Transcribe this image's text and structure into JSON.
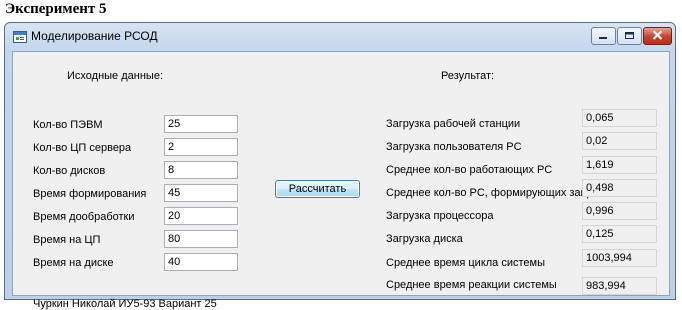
{
  "document": {
    "heading": "Эксперимент 5"
  },
  "window": {
    "title": "Моделирование РСОД"
  },
  "input_section": {
    "header": "Исходные данные:",
    "fields": [
      {
        "label": "Кол-во ПЭВМ",
        "value": "25"
      },
      {
        "label": "Кол-во ЦП сервера",
        "value": "2"
      },
      {
        "label": "Кол-во дисков",
        "value": "8"
      },
      {
        "label": "Время формирования",
        "value": "45"
      },
      {
        "label": "Время дообработки",
        "value": "20"
      },
      {
        "label": "Время на ЦП",
        "value": "80"
      },
      {
        "label": "Время на диске",
        "value": "40"
      }
    ]
  },
  "calculate_button": {
    "label": "Рассчитать"
  },
  "result_section": {
    "header": "Результат:",
    "fields": [
      {
        "label": "Загрузка рабочей станции",
        "value": "0,065"
      },
      {
        "label": "Загрузка пользователя PC",
        "value": "0,02"
      },
      {
        "label": "Среднее кол-во работающих PC",
        "value": "1,619"
      },
      {
        "label": "Среднее кол-во PC, формирующих запрос",
        "value": "0,498"
      },
      {
        "label": "Загрузка процессора",
        "value": "0,996"
      },
      {
        "label": "Загрузка диска",
        "value": "0,125"
      },
      {
        "label": "Среднее время цикла системы",
        "value": "1003,994"
      },
      {
        "label": "Среднее время реакции системы",
        "value": "983,994"
      }
    ]
  },
  "footer": {
    "text": "Чуркин Николай ИУ5-93 Вариант 25"
  },
  "colors": {
    "titlebar": "#c2d6ec",
    "client_bg": "#f0f0f0",
    "close_button": "#c6412c",
    "button_border": "#3c7fb1"
  }
}
